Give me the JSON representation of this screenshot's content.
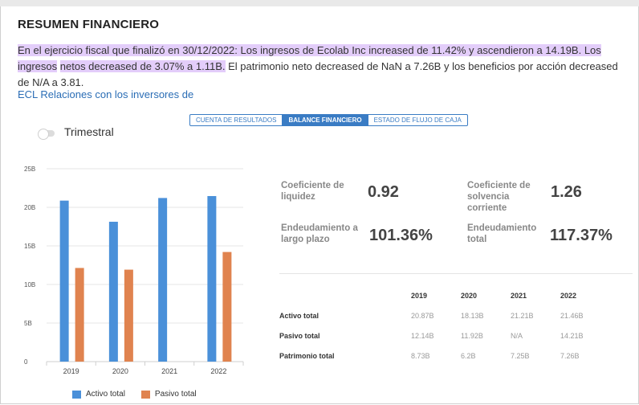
{
  "header": {
    "title": "RESUMEN FINANCIERO"
  },
  "summary": {
    "hl1": "En el ejercicio fiscal que finalizó en 30/12/2022: Los ingresos de Ecolab Inc increased de 11.42% y ascendieron a 14.19B. Los ingresos",
    "hl2": "netos decreased de 3.07% a 1.11B.",
    "rest": " El patrimonio neto decreased de NaN a 7.26B y los beneficios por acción decreased de N/A a 3.81."
  },
  "ir_link": "ECL Relaciones con los inversores de",
  "tabs": [
    "CUENTA DE RESULTADOS",
    "BALANCE FINANCIERO",
    "ESTADO DE FLUJO DE CAJA"
  ],
  "toggle": {
    "label": "Trimestral",
    "on": false
  },
  "metrics": {
    "liquidez_label": "Coeficiente de liquidez",
    "liquidez_value": "0.92",
    "solvencia_label": "Coeficiente de solvencia corriente",
    "solvencia_value": "1.26",
    "largo_label": "Endeudamiento a largo plazo",
    "largo_value": "101.36%",
    "total_label": "Endeudamiento total",
    "total_value": "117.37%"
  },
  "table": {
    "years": [
      "2019",
      "2020",
      "2021",
      "2022"
    ],
    "rows": [
      {
        "label": "Activo total",
        "values": [
          "20.87B",
          "18.13B",
          "21.21B",
          "21.46B"
        ]
      },
      {
        "label": "Pasivo total",
        "values": [
          "12.14B",
          "11.92B",
          "N/A",
          "14.21B"
        ]
      },
      {
        "label": "Patrimonio total",
        "values": [
          "8.73B",
          "6.2B",
          "7.25B",
          "7.26B"
        ]
      }
    ]
  },
  "colors": {
    "activo": "#4a90d9",
    "pasivo": "#e0834f",
    "accent": "#3a7cc4",
    "highlight": "#e3cdfa"
  },
  "chart_data": {
    "type": "bar",
    "categories": [
      "2019",
      "2020",
      "2021",
      "2022"
    ],
    "series": [
      {
        "name": "Activo total",
        "values": [
          20.87,
          18.13,
          21.21,
          21.46
        ]
      },
      {
        "name": "Pasivo total",
        "values": [
          12.14,
          11.92,
          null,
          14.21
        ]
      }
    ],
    "y_ticks": [
      "0",
      "5B",
      "10B",
      "15B",
      "20B",
      "25B"
    ],
    "ylim": [
      0,
      25
    ],
    "grid": true,
    "legend": "bottom"
  }
}
